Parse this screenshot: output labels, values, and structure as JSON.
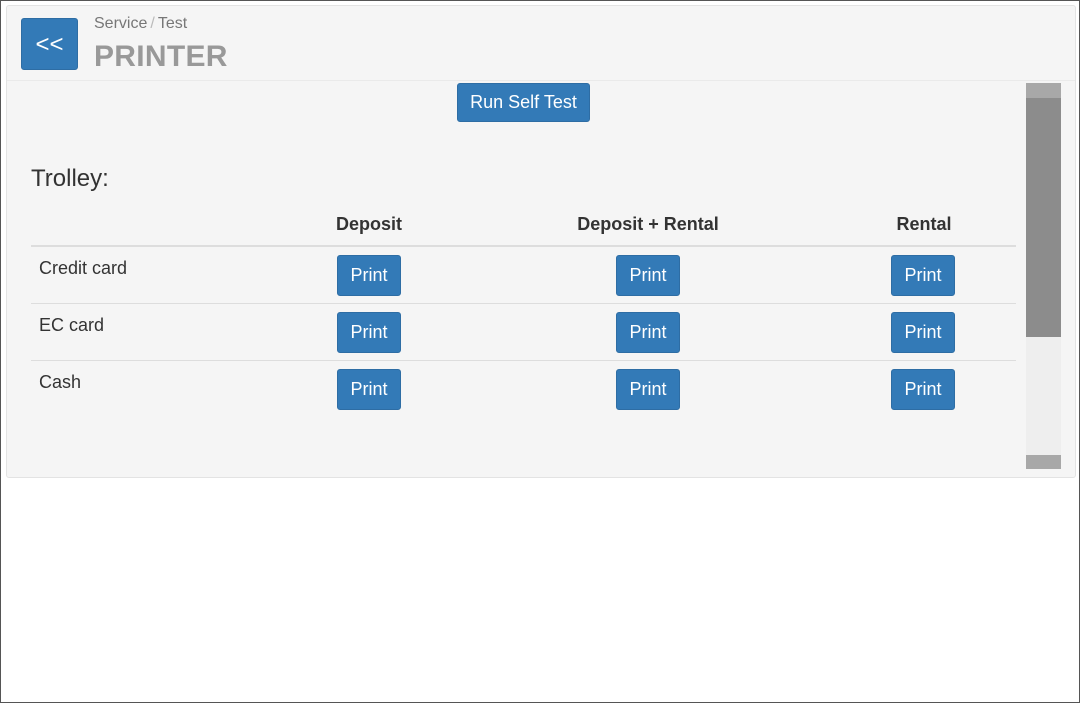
{
  "header": {
    "back_label": "<<",
    "breadcrumb": [
      "Service",
      "Test"
    ],
    "breadcrumb_separator": "/",
    "title": "PRINTER"
  },
  "actions": {
    "self_test_label": "Run Self Test"
  },
  "section": {
    "title": "Trolley:"
  },
  "table": {
    "columns": [
      "",
      "Deposit",
      "Deposit + Rental",
      "Rental"
    ],
    "rows": [
      {
        "label": "Credit card",
        "buttons": [
          "Print",
          "Print",
          "Print"
        ]
      },
      {
        "label": "EC card",
        "buttons": [
          "Print",
          "Print",
          "Print"
        ]
      },
      {
        "label": "Cash",
        "buttons": [
          "Print",
          "Print",
          "Print"
        ]
      }
    ]
  },
  "colors": {
    "primary": "#337ab7",
    "panel_bg": "#f5f5f5",
    "title_gray": "#999999"
  }
}
